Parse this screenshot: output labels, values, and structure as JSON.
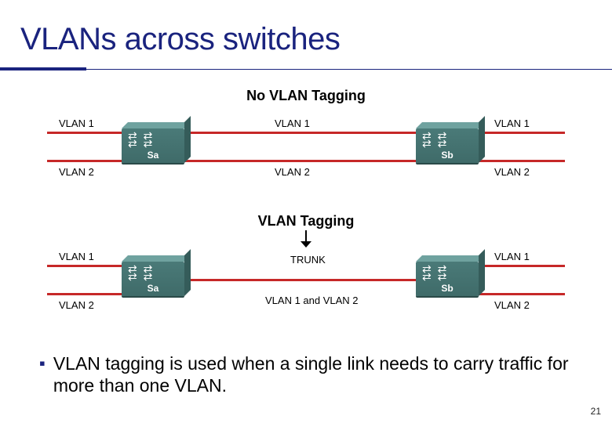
{
  "title": "VLANs across switches",
  "subtitles": {
    "no_tag": "No VLAN Tagging",
    "tag": "VLAN Tagging"
  },
  "diagram1": {
    "vlan1": "VLAN 1",
    "vlan2": "VLAN 2",
    "switch_a": "Sa",
    "switch_b": "Sb"
  },
  "diagram2": {
    "vlan1": "VLAN 1",
    "vlan2": "VLAN 2",
    "trunk": "TRUNK",
    "mix": "VLAN 1 and VLAN 2",
    "switch_a": "Sa",
    "switch_b": "Sb"
  },
  "bullet": "VLAN tagging is used when a single link needs to carry traffic for more than one VLAN.",
  "page_number": "21"
}
